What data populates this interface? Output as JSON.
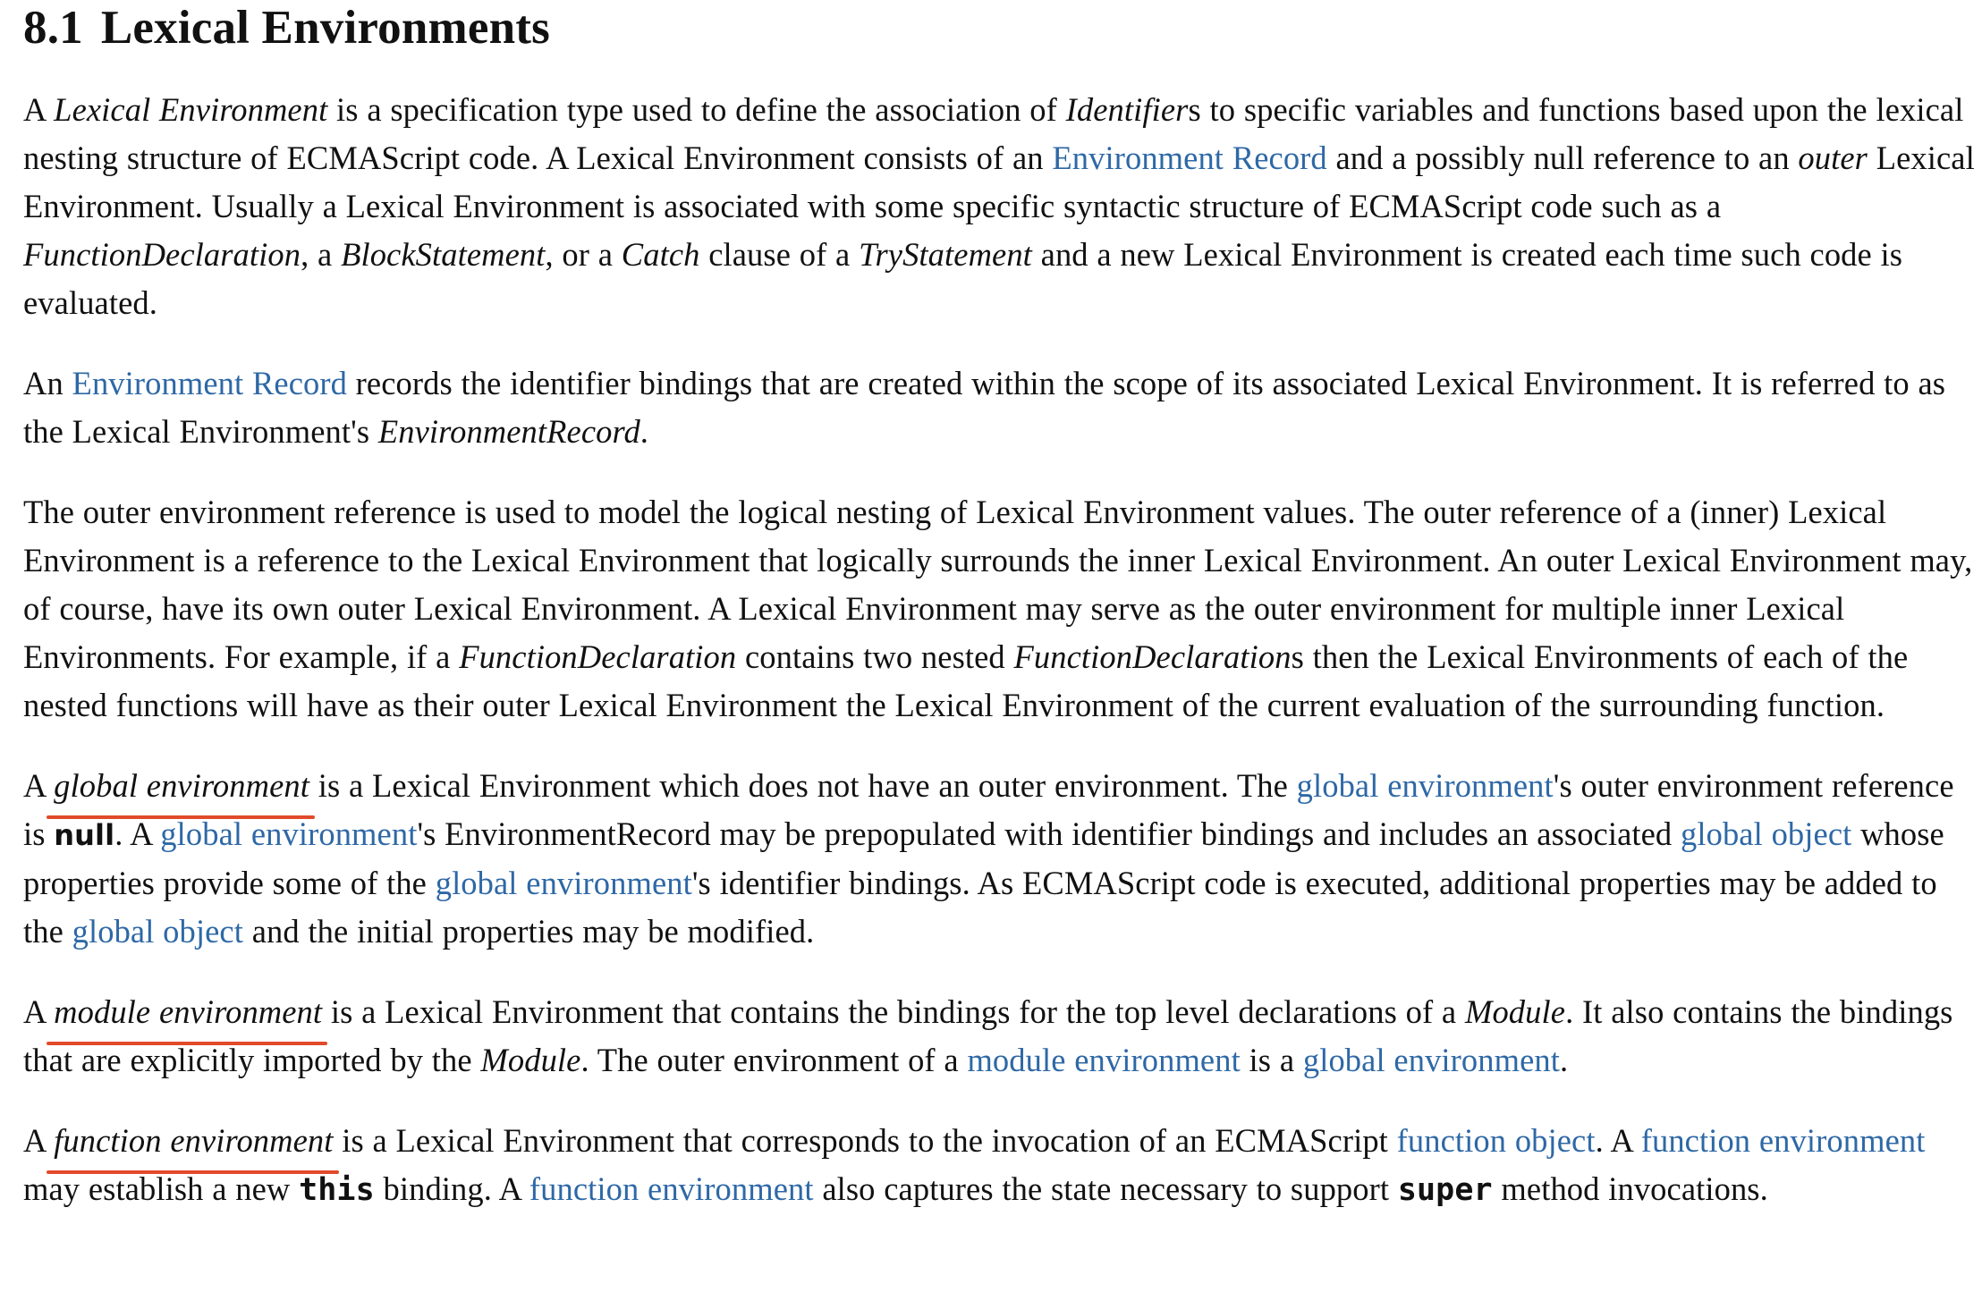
{
  "heading": {
    "number": "8.1",
    "title": "Lexical Environments"
  },
  "colors": {
    "link": "#2e68a6",
    "text": "#111111",
    "underline_annotation": "#e14a2a"
  },
  "p1": {
    "t1": "A ",
    "i1": "Lexical Environment",
    "t2": " is a specification type used to define the association of ",
    "i2": "Identifier",
    "t3": "s to specific variables and functions based upon the lexical nesting structure of ECMAScript code. A Lexical Environment consists of an ",
    "l1": "Environment Record",
    "t4": " and a possibly null reference to an ",
    "i3": "outer",
    "t5": " Lexical Environment. Usually a Lexical Environment is associated with some specific syntactic structure of ECMAScript code such as a ",
    "i4": "FunctionDeclaration",
    "t6": ", a ",
    "i5": "BlockStatement",
    "t7": ", or a ",
    "i6": "Catch",
    "t8": " clause of a ",
    "i7": "TryStatement",
    "t9": " and a new Lexical Environment is created each time such code is evaluated."
  },
  "p2": {
    "t1": "An ",
    "l1": "Environment Record",
    "t2": " records the identifier bindings that are created within the scope of its associated Lexical Environment. It is referred to as the Lexical Environment's ",
    "i1": "EnvironmentRecord",
    "t3": "."
  },
  "p3": {
    "t1": "The outer environment reference is used to model the logical nesting of Lexical Environment values. The outer reference of a (inner) Lexical Environment is a reference to the Lexical Environment that logically surrounds the inner Lexical Environment. An outer Lexical Environment may, of course, have its own outer Lexical Environment. A Lexical Environment may serve as the outer environment for multiple inner Lexical Environments. For example, if a ",
    "i1": "FunctionDeclaration",
    "t2": " contains two nested ",
    "i2": "FunctionDeclaration",
    "t3": "s then the Lexical Environments of each of the nested functions will have as their outer Lexical Environment the Lexical Environment of the current evaluation of the surrounding function."
  },
  "p4": {
    "t1": "A ",
    "term": "global environment",
    "t2": " is a Lexical Environment which does not have an outer environment. The ",
    "l1": "global environment",
    "t3": "'s outer environment reference is ",
    "b1": "null",
    "t4": ". A ",
    "l2": "global environment",
    "t5": "'s EnvironmentRecord may be prepopulated with identifier bindings and includes an associated ",
    "l3": "global object",
    "t6": " whose properties provide some of the ",
    "l4": "global environment",
    "t7": "'s identifier bindings. As ECMAScript code is executed, additional properties may be added to the ",
    "l5": "global object",
    "t8": " and the initial properties may be modified."
  },
  "p5": {
    "t1": "A ",
    "term": "module environment",
    "t2": " is a Lexical Environment that contains the bindings for the top level declarations of a ",
    "i1": "Module",
    "t3": ". It also contains the bindings that are explicitly imported by the ",
    "i2": "Module",
    "t4": ". The outer environment of a ",
    "l1": "module environment",
    "t5": " is a ",
    "l2": "global environment",
    "t6": "."
  },
  "p6": {
    "t1": "A ",
    "term": "function environment",
    "t2": " is a Lexical Environment that corresponds to the invocation of an ECMAScript ",
    "l1": "function object",
    "t3": ". A ",
    "l2": "function environment",
    "t4": " may establish a new ",
    "c1": "this",
    "t5": " binding. A ",
    "l3": "function environment",
    "t6": " also captures the state necessary to support ",
    "c2": "super",
    "t7": " method invocations."
  }
}
